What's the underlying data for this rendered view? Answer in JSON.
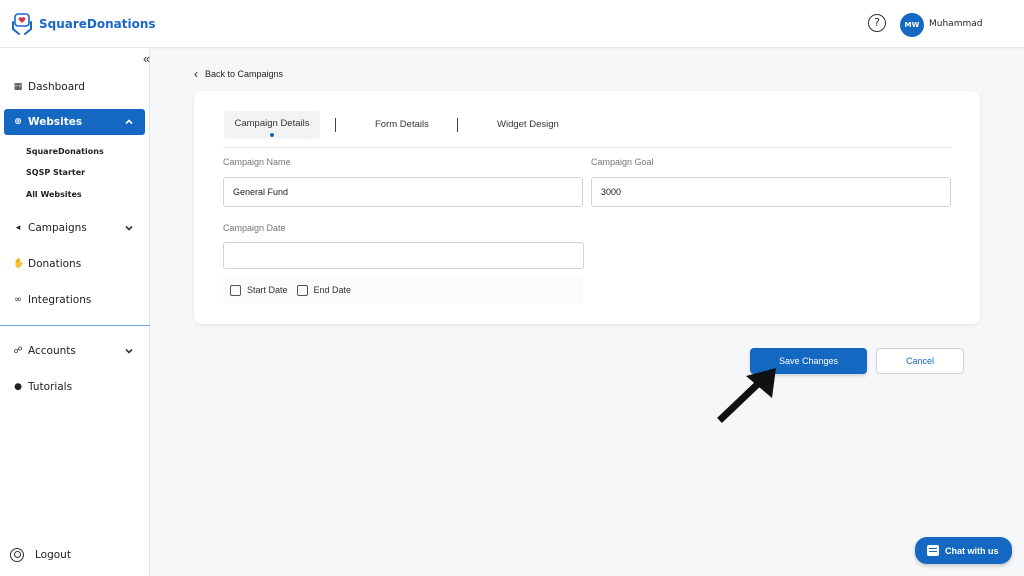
{
  "header": {
    "brand": "SquareDonations",
    "help_glyph": "?",
    "avatar_initials": "MW",
    "user_name": "Muhammad"
  },
  "sidebar": {
    "collapse_glyph": "«",
    "items": [
      {
        "label": "Dashboard",
        "icon": "grid-icon"
      },
      {
        "label": "Websites",
        "icon": "globe-icon",
        "active": true,
        "expanded": true
      },
      {
        "label": "Campaigns",
        "icon": "megaphone-icon"
      },
      {
        "label": "Donations",
        "icon": "hand-donation-icon"
      },
      {
        "label": "Integrations",
        "icon": "link-icon"
      },
      {
        "label": "Accounts",
        "icon": "users-icon"
      },
      {
        "label": "Tutorials",
        "icon": "info-icon"
      }
    ],
    "websites": [
      "SquareDonations",
      "SQSP Starter",
      "All Websites"
    ],
    "logout": "Logout"
  },
  "page": {
    "back_label": "Back to Campaigns",
    "tabs": [
      "Campaign Details",
      "Form Details",
      "Widget Design"
    ],
    "form": {
      "name_label": "Campaign Name",
      "name_value": "General Fund",
      "goal_label": "Campaign Goal",
      "goal_value": "3000",
      "date_label": "Campaign Date",
      "date_value": "",
      "start_date": "Start Date",
      "end_date": "End Date"
    },
    "save_label": "Save Changes",
    "cancel_label": "Cancel"
  },
  "chat": {
    "label": "Chat with us"
  },
  "colors": {
    "accent": "#1468c2",
    "background": "#f6f7f9"
  }
}
